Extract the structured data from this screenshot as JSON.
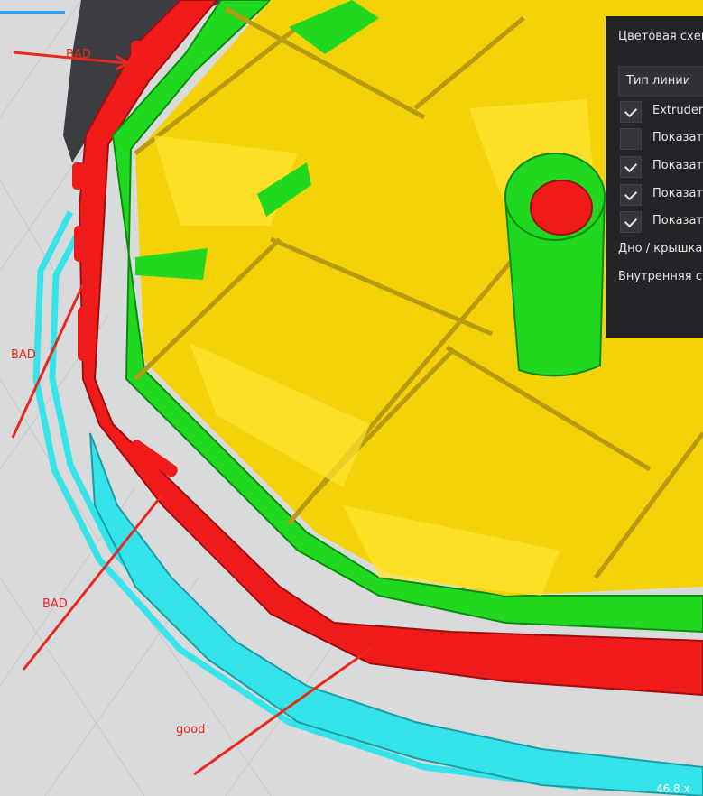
{
  "annotations": [
    {
      "id": "bad-1",
      "text": "BAD"
    },
    {
      "id": "bad-2",
      "text": "BAD"
    },
    {
      "id": "bad-3",
      "text": "BAD"
    },
    {
      "id": "good",
      "text": "good"
    }
  ],
  "panel": {
    "title": "Цветовая схема",
    "select_value": "Тип линии",
    "checkboxes": [
      {
        "label": "Extruder",
        "checked": true
      },
      {
        "label": "Показать",
        "checked": false
      },
      {
        "label": "Показать",
        "checked": true
      },
      {
        "label": "Показать",
        "checked": true
      },
      {
        "label": "Показать",
        "checked": true
      }
    ],
    "row_dno": "Дно / крышка",
    "row_inner": "Внутренняя стенка"
  },
  "dims": "46.8 x",
  "colors": {
    "red": "#ef1b1b",
    "green": "#1fd81f",
    "yellow": "#f4d20a",
    "dark_yellow": "#b89a10",
    "cyan": "#35e3ea",
    "panel": "#232427",
    "bed": "#d9dadc"
  }
}
